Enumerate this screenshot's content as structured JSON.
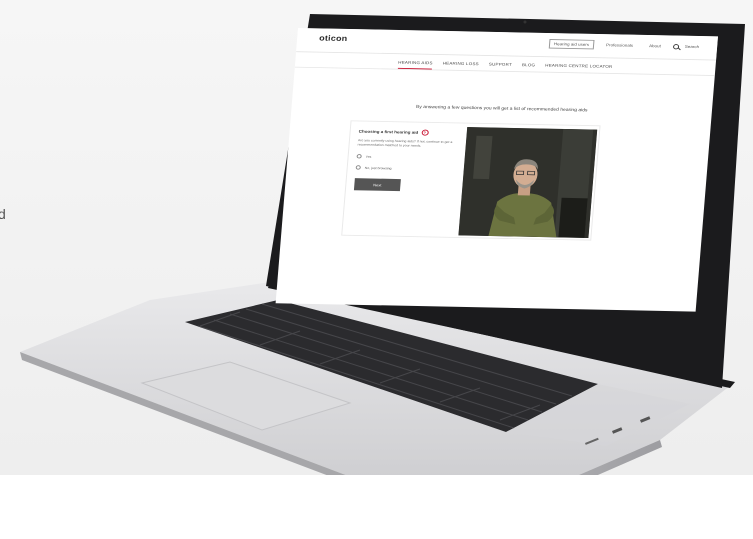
{
  "scene": {
    "edge_text": "d"
  },
  "site": {
    "logo": "oticon",
    "utility_nav": [
      {
        "label": "Hearing aid users",
        "active": true
      },
      {
        "label": "Professionals",
        "active": false
      },
      {
        "label": "About",
        "active": false
      }
    ],
    "search_label": "Search",
    "main_nav": [
      {
        "label": "HEARING AIDS",
        "active": true
      },
      {
        "label": "HEARING LOSS",
        "active": false
      },
      {
        "label": "SUPPORT",
        "active": false
      },
      {
        "label": "BLOG",
        "active": false
      },
      {
        "label": "HEARING CENTRE LOCATOR",
        "active": false
      }
    ]
  },
  "quiz": {
    "intro": "By answering a few questions you will get a list of recommended hearing aids",
    "heading": "Choosing a first hearing aid",
    "help": "?",
    "body": "Are you currently using hearing aids? If not, continue to get a recommendation matched to your needs.",
    "options": [
      "Yes",
      "No, just browsing"
    ],
    "next_label": "Next"
  },
  "colors": {
    "accent": "#c8102e",
    "button": "#555555",
    "aluminum": "#d4d4d6",
    "bezel": "#1b1b1d"
  }
}
